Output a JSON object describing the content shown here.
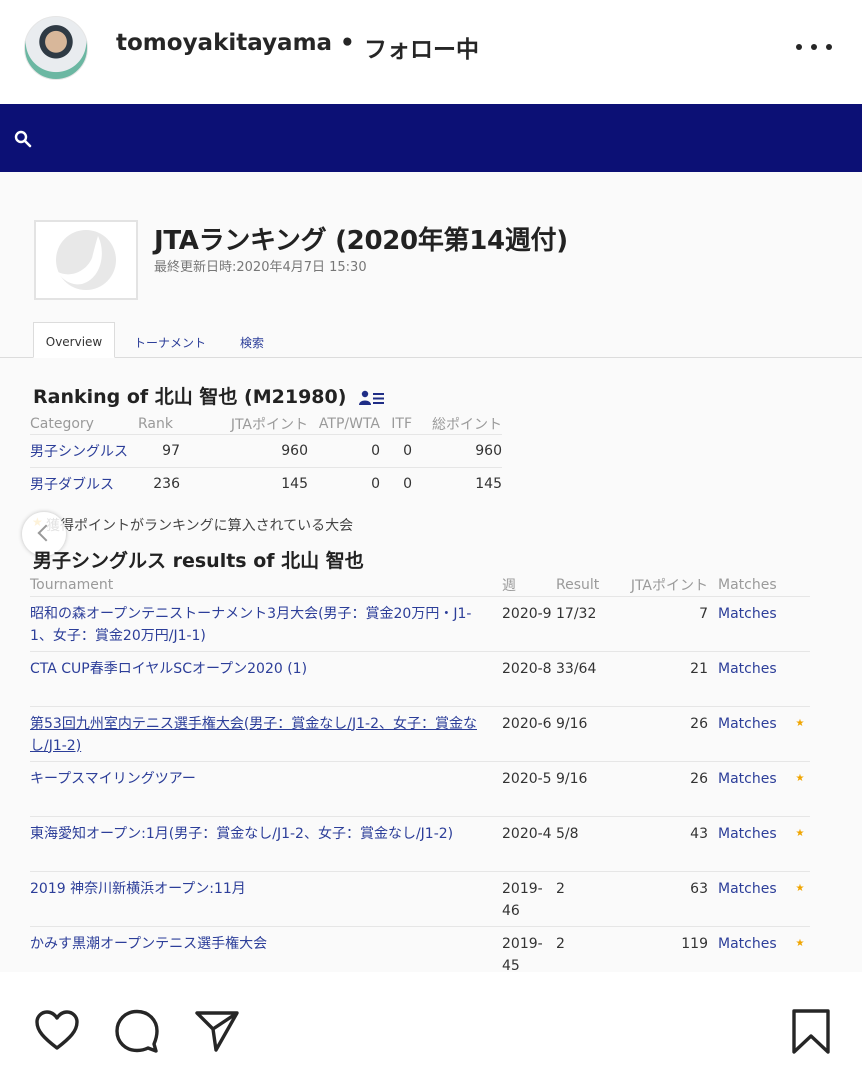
{
  "post": {
    "username": "tomoyakitayama",
    "separator": "•",
    "follow_status": "フォロー中"
  },
  "site": {
    "title": "JTAランキング (2020年第14週付)",
    "updated": "最終更新日時:2020年4月7日 15:30",
    "tabs": [
      "Overview",
      "トーナメント",
      "検索"
    ]
  },
  "ranking": {
    "title": "Ranking of 北山 智也 (M21980)",
    "headers": [
      "Category",
      "Rank",
      "JTAポイント",
      "ATP/WTA",
      "ITF",
      "総ポイント"
    ],
    "rows": [
      {
        "category": "男子シングルス",
        "rank": "97",
        "jta": "960",
        "atp": "0",
        "itf": "0",
        "total": "960"
      },
      {
        "category": "男子ダブルス",
        "rank": "236",
        "jta": "145",
        "atp": "0",
        "itf": "0",
        "total": "145"
      }
    ],
    "note": "獲得ポイントがランキングに算入されている大会"
  },
  "results": {
    "title": "男子シングルス results of 北山 智也",
    "headers": [
      "Tournament",
      "週",
      "Result",
      "JTAポイント",
      "Matches"
    ],
    "rows": [
      {
        "tournament": "昭和の森オープンテニストーナメント3月大会(男子：賞金20万円・J1-1、女子：賞金20万円/J1-1)",
        "week": "2020-9",
        "result": "17/32",
        "points": "7",
        "matches": "Matches",
        "star": ""
      },
      {
        "tournament": "CTA CUP春季ロイヤルSCオープン2020 (1)",
        "week": "2020-8",
        "result": "33/64",
        "points": "21",
        "matches": "Matches",
        "star": ""
      },
      {
        "tournament": "第53回九州室内テニス選手権大会(男子：賞金なし/J1-2、女子：賞金なし/J1-2)",
        "week": "2020-6",
        "result": "9/16",
        "points": "26",
        "matches": "Matches",
        "star": "★"
      },
      {
        "tournament": "キープスマイリングツアー",
        "week": "2020-5",
        "result": "9/16",
        "points": "26",
        "matches": "Matches",
        "star": "★"
      },
      {
        "tournament": "東海愛知オープン:1月(男子：賞金なし/J1-2、女子：賞金なし/J1-2)",
        "week": "2020-4",
        "result": "5/8",
        "points": "43",
        "matches": "Matches",
        "star": "★"
      },
      {
        "tournament": "2019 神奈川新横浜オープン:11月",
        "week": "2019-46",
        "result": "2",
        "points": "63",
        "matches": "Matches",
        "star": "★"
      },
      {
        "tournament": "かみす黒潮オープンテニス選手権大会",
        "week": "2019-45",
        "result": "2",
        "points": "119",
        "matches": "Matches",
        "star": "★"
      }
    ]
  },
  "icons": {
    "more": "more-options-icon",
    "search": "search-icon",
    "like": "heart-icon",
    "comment": "comment-icon",
    "share": "send-icon",
    "save": "bookmark-icon"
  },
  "colors": {
    "navbar": "#0c1075",
    "link": "#2c3e99",
    "star": "#f0a500"
  }
}
